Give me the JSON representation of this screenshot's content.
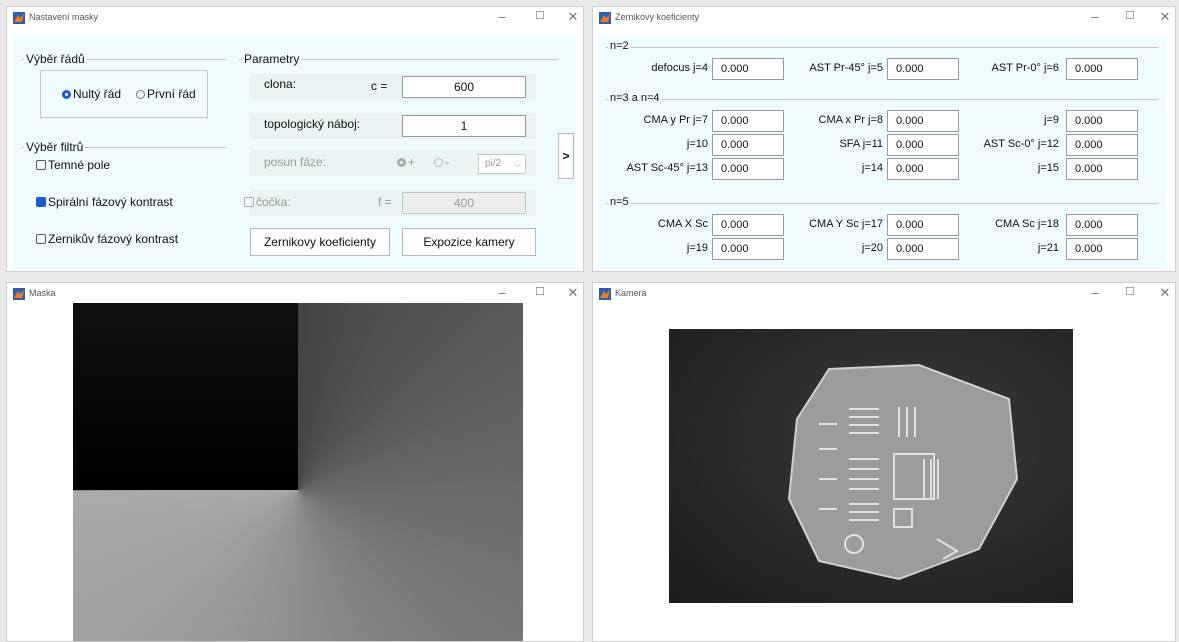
{
  "nastaveni": {
    "title": "Nastavení masky",
    "vyber_radu": {
      "title": "Výběr řádů",
      "options": [
        {
          "label": "Nultý řád",
          "selected": true
        },
        {
          "label": "První řád",
          "selected": false
        }
      ]
    },
    "vyber_filtru": {
      "title": "Výběr filtrů",
      "items": [
        {
          "label": "Temné pole",
          "checked": false
        },
        {
          "label": "Spirální fázový kontrast",
          "checked": true
        },
        {
          "label": "Zernikův fázový kontrast",
          "checked": false
        }
      ]
    },
    "parametry": {
      "title": "Parametry",
      "clona_label": "clona:",
      "clona_var": "c =",
      "clona_value": "600",
      "topo_label": "topologický náboj:",
      "topo_value": "1",
      "posun_label": "posun fáze:",
      "posun_plus": "+",
      "posun_minus": "-",
      "posun_select": "pi/2",
      "cocka_label": "čočka:",
      "cocka_var": "f =",
      "cocka_value": "400",
      "zernike_button": "Zernikovy koeficienty",
      "expozice_button": "Expozice kamery"
    },
    "arrow_button": ">"
  },
  "zernike": {
    "title": "Zernikovy koeficienty",
    "groups": [
      {
        "title": "n=2",
        "rows": [
          [
            {
              "label": "defocus  j=4",
              "value": "0.000"
            },
            {
              "label": "AST Pr-45° j=5",
              "value": "0.000"
            },
            {
              "label": "AST Pr-0° j=6",
              "value": "0.000"
            }
          ]
        ]
      },
      {
        "title": "n=3 a n=4",
        "rows": [
          [
            {
              "label": "CMA y Pr  j=7",
              "value": "0.000"
            },
            {
              "label": "CMA x Pr  j=8",
              "value": "0.000"
            },
            {
              "label": "j=9",
              "value": "0.000"
            }
          ],
          [
            {
              "label": "j=10",
              "value": "0.000"
            },
            {
              "label": "SFA j=11",
              "value": "0.000"
            },
            {
              "label": "AST Sc-0° j=12",
              "value": "0.000"
            }
          ],
          [
            {
              "label": "AST Sc-45° j=13",
              "value": "0.000"
            },
            {
              "label": "j=14",
              "value": "0.000"
            },
            {
              "label": "j=15",
              "value": "0.000"
            }
          ]
        ]
      },
      {
        "title": "n=5",
        "rows": [
          [
            {
              "label": "CMA X Sc",
              "value": "0.000"
            },
            {
              "label": "CMA Y Sc  j=17",
              "value": "0.000"
            },
            {
              "label": "CMA Sc  j=18",
              "value": "0.000"
            }
          ],
          [
            {
              "label": "j=19",
              "value": "0.000"
            },
            {
              "label": "j=20",
              "value": "0.000"
            },
            {
              "label": "j=21",
              "value": "0.000"
            }
          ]
        ]
      }
    ]
  },
  "maska": {
    "title": "Maska"
  },
  "kamera": {
    "title": "Kamera"
  },
  "window_controls": {
    "minimize": "–",
    "maximize": "☐",
    "close": "✕"
  },
  "colors": {
    "accent": "#1c5bd0",
    "panel": "#eefcfd"
  }
}
